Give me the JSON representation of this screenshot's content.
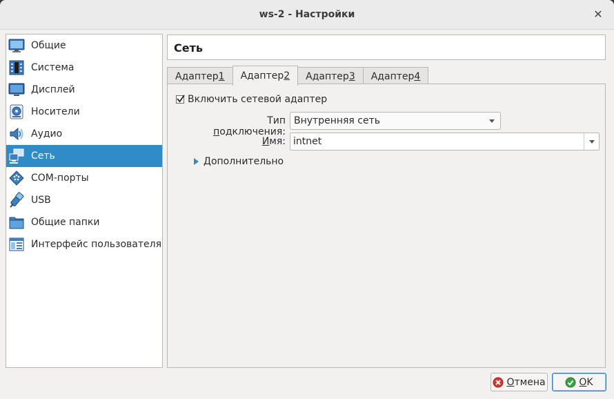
{
  "window": {
    "title": "ws-2 - Настройки"
  },
  "sidebar": {
    "items": [
      {
        "label": "Общие",
        "icon": "general-monitor-icon",
        "selected": false
      },
      {
        "label": "Система",
        "icon": "system-chip-icon",
        "selected": false
      },
      {
        "label": "Дисплей",
        "icon": "display-monitor-icon",
        "selected": false
      },
      {
        "label": "Носители",
        "icon": "storage-disk-icon",
        "selected": false
      },
      {
        "label": "Аудио",
        "icon": "audio-speaker-icon",
        "selected": false
      },
      {
        "label": "Сеть",
        "icon": "network-icon",
        "selected": true
      },
      {
        "label": "COM-порты",
        "icon": "serial-port-icon",
        "selected": false
      },
      {
        "label": "USB",
        "icon": "usb-icon",
        "selected": false
      },
      {
        "label": "Общие папки",
        "icon": "shared-folder-icon",
        "selected": false
      },
      {
        "label": "Интерфейс пользователя",
        "icon": "user-interface-icon",
        "selected": false
      }
    ]
  },
  "page": {
    "title": "Сеть"
  },
  "tabs": [
    {
      "pre": "Адаптер ",
      "key": "1",
      "active": false
    },
    {
      "pre": "Адаптер ",
      "key": "2",
      "active": true
    },
    {
      "pre": "Адаптер ",
      "key": "3",
      "active": false
    },
    {
      "pre": "Адаптер ",
      "key": "4",
      "active": false
    }
  ],
  "adapter": {
    "enable_label": "Включить сетевой адаптер",
    "enabled": true,
    "attach_label_pre": "Тип ",
    "attach_label_key": "п",
    "attach_label_post": "одключения:",
    "attach_value": "Внутренняя сеть",
    "name_label_key": "И",
    "name_label_post": "мя:",
    "name_value": "intnet",
    "advanced_key": "Д",
    "advanced_post": "ополнительно"
  },
  "buttons": {
    "cancel_key": "О",
    "cancel_post": "тмена",
    "ok_key": "O",
    "ok_post": "K"
  },
  "colors": {
    "accent": "#308cc6",
    "selection_text": "#ffffff",
    "ok_icon": "#3aa341",
    "cancel_icon": "#d9342b"
  }
}
